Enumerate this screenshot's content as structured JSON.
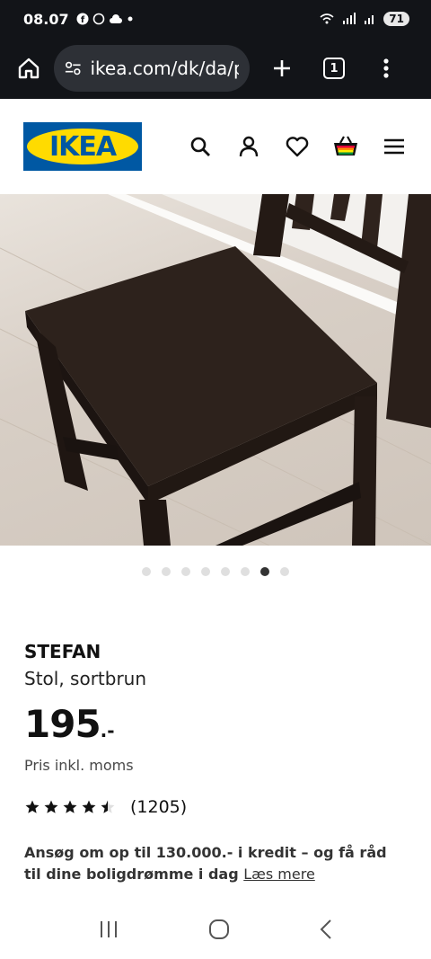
{
  "status_bar": {
    "time": "08.07",
    "battery": "71"
  },
  "browser": {
    "url": "ikea.com/dk/da/p/",
    "tab_count": "1"
  },
  "header": {
    "logo_text": "IKEA",
    "icons": [
      "search-icon",
      "user-icon",
      "heart-icon",
      "cart-icon",
      "menu-icon"
    ]
  },
  "carousel": {
    "total": 8,
    "active_index": 6
  },
  "product": {
    "name": "STEFAN",
    "description": "Stol, sortbrun",
    "price": "195",
    "price_suffix": ".-",
    "vat_note": "Pris inkl. moms",
    "rating": 4.5,
    "review_count": "(1205)",
    "credit_text": "Ansøg om op til 130.000.- i kredit – og få råd til dine boligdrømme i dag",
    "read_more": "Læs mere"
  },
  "colors": {
    "ikea_blue": "#0058a3",
    "ikea_yellow": "#ffdb00",
    "chair_brown": "#2a1f1a"
  }
}
